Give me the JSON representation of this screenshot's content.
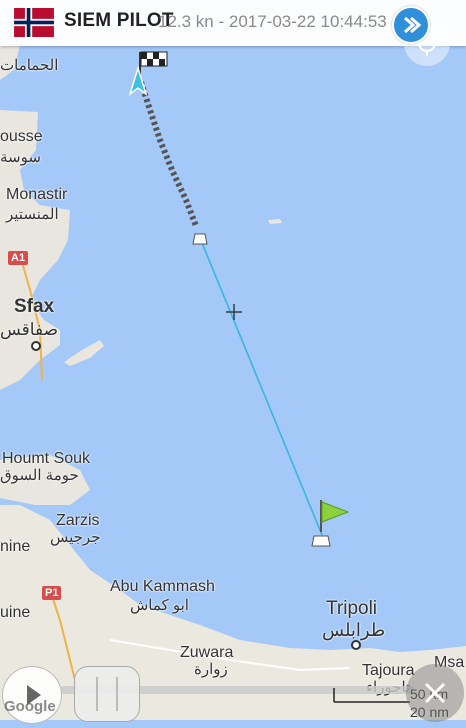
{
  "header": {
    "vessel_name": "SIEM PILOT",
    "info_text": "12.3 kn - 2017-03-22 10:44:53",
    "flag": "norway-flag"
  },
  "map": {
    "labels": {
      "sousse": "ousse",
      "sousse_ar": "سوسة",
      "top_ar": "الحمامات",
      "monastir": "Monastir",
      "monastir_ar": "المنستير",
      "sfax": "Sfax",
      "sfax_ar": "صفاقس",
      "houmt_souk": "Houmt Souk",
      "houmt_souk_ar": "حومة السوق",
      "zarzis": "Zarzis",
      "zarzis_ar": "جرجيس",
      "nine": "nine",
      "uine": "uine",
      "abu_kammash": "Abu Kammash",
      "abu_kammash_ar": "ابو كماش",
      "zuwara": "Zuwara",
      "zuwara_ar": "زوارة",
      "tripoli": "Tripoli",
      "tripoli_ar": "طرابلس",
      "tajoura": "Tajoura",
      "tajoura_ar": "تاجوراء",
      "msa": "Msa"
    },
    "roads": {
      "a1": "A1",
      "p1": "P1"
    }
  },
  "scale": {
    "km": "50 km",
    "nm": "20 nm"
  },
  "controls": {
    "play_icon": "play-icon",
    "close_icon": "close-icon",
    "share_icon": "share-icon",
    "locate_icon": "locate-icon"
  },
  "watermark": "Google"
}
